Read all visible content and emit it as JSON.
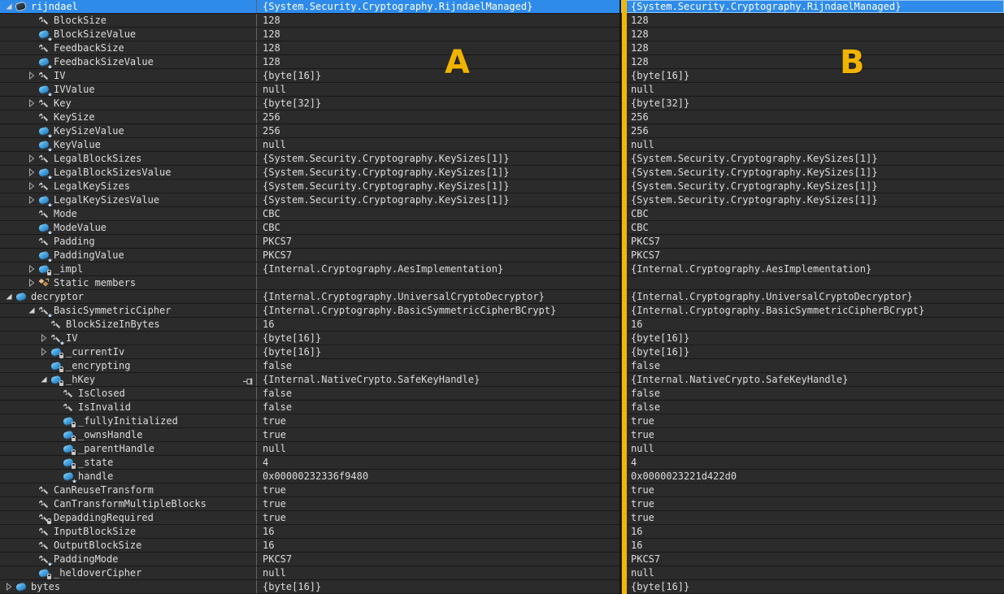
{
  "app": {
    "description": "debugger-watch-comparison",
    "root_object_type": "{System.Security.Cryptography.RijndaelManaged}"
  },
  "colors": {
    "background": "#2B2B2C",
    "selection_blue": "#2E8BEA",
    "divider_yellow": "#F2B705",
    "annotation_gold": "#F0B400",
    "row_line": "#19191A",
    "text": "#DCDCDC",
    "field_icon_blue": "#45A3DF",
    "property_icon_gray": "#C4C4C4",
    "static_icon_tan": "#DFAF72"
  },
  "annotations": {
    "panel_a_label": "A",
    "panel_b_label": "B"
  },
  "rows": [
    {
      "name": "rijndael",
      "level": 0,
      "expander": "expanded",
      "icon": "object",
      "pinned": false,
      "selected": true,
      "value_a": "{System.Security.Cryptography.RijndaelManaged}",
      "value_b": "{System.Security.Cryptography.RijndaelManaged}"
    },
    {
      "name": "BlockSize",
      "level": 1,
      "expander": "none",
      "icon": "property",
      "pinned": false,
      "selected": false,
      "value_a": "128",
      "value_b": "128"
    },
    {
      "name": "BlockSizeValue",
      "level": 1,
      "expander": "none",
      "icon": "field-protected",
      "pinned": false,
      "selected": false,
      "value_a": "128",
      "value_b": "128"
    },
    {
      "name": "FeedbackSize",
      "level": 1,
      "expander": "none",
      "icon": "property",
      "pinned": false,
      "selected": false,
      "value_a": "128",
      "value_b": "128"
    },
    {
      "name": "FeedbackSizeValue",
      "level": 1,
      "expander": "none",
      "icon": "field-protected",
      "pinned": false,
      "selected": false,
      "value_a": "128",
      "value_b": "128"
    },
    {
      "name": "IV",
      "level": 1,
      "expander": "collapsed",
      "icon": "property",
      "pinned": false,
      "selected": false,
      "value_a": "{byte[16]}",
      "value_b": "{byte[16]}"
    },
    {
      "name": "IVValue",
      "level": 1,
      "expander": "none",
      "icon": "field-protected",
      "pinned": false,
      "selected": false,
      "value_a": "null",
      "value_b": "null"
    },
    {
      "name": "Key",
      "level": 1,
      "expander": "collapsed",
      "icon": "property",
      "pinned": false,
      "selected": false,
      "value_a": "{byte[32]}",
      "value_b": "{byte[32]}"
    },
    {
      "name": "KeySize",
      "level": 1,
      "expander": "none",
      "icon": "property",
      "pinned": false,
      "selected": false,
      "value_a": "256",
      "value_b": "256"
    },
    {
      "name": "KeySizeValue",
      "level": 1,
      "expander": "none",
      "icon": "field-protected",
      "pinned": false,
      "selected": false,
      "value_a": "256",
      "value_b": "256"
    },
    {
      "name": "KeyValue",
      "level": 1,
      "expander": "none",
      "icon": "field-protected",
      "pinned": false,
      "selected": false,
      "value_a": "null",
      "value_b": "null"
    },
    {
      "name": "LegalBlockSizes",
      "level": 1,
      "expander": "collapsed",
      "icon": "property",
      "pinned": false,
      "selected": false,
      "value_a": "{System.Security.Cryptography.KeySizes[1]}",
      "value_b": "{System.Security.Cryptography.KeySizes[1]}"
    },
    {
      "name": "LegalBlockSizesValue",
      "level": 1,
      "expander": "collapsed",
      "icon": "field-protected",
      "pinned": false,
      "selected": false,
      "value_a": "{System.Security.Cryptography.KeySizes[1]}",
      "value_b": "{System.Security.Cryptography.KeySizes[1]}"
    },
    {
      "name": "LegalKeySizes",
      "level": 1,
      "expander": "collapsed",
      "icon": "property",
      "pinned": false,
      "selected": false,
      "value_a": "{System.Security.Cryptography.KeySizes[1]}",
      "value_b": "{System.Security.Cryptography.KeySizes[1]}"
    },
    {
      "name": "LegalKeySizesValue",
      "level": 1,
      "expander": "collapsed",
      "icon": "field-protected",
      "pinned": false,
      "selected": false,
      "value_a": "{System.Security.Cryptography.KeySizes[1]}",
      "value_b": "{System.Security.Cryptography.KeySizes[1]}"
    },
    {
      "name": "Mode",
      "level": 1,
      "expander": "none",
      "icon": "property",
      "pinned": false,
      "selected": false,
      "value_a": "CBC",
      "value_b": "CBC"
    },
    {
      "name": "ModeValue",
      "level": 1,
      "expander": "none",
      "icon": "field-protected",
      "pinned": false,
      "selected": false,
      "value_a": "CBC",
      "value_b": "CBC"
    },
    {
      "name": "Padding",
      "level": 1,
      "expander": "none",
      "icon": "property",
      "pinned": false,
      "selected": false,
      "value_a": "PKCS7",
      "value_b": "PKCS7"
    },
    {
      "name": "PaddingValue",
      "level": 1,
      "expander": "none",
      "icon": "field-protected",
      "pinned": false,
      "selected": false,
      "value_a": "PKCS7",
      "value_b": "PKCS7"
    },
    {
      "name": "_impl",
      "level": 1,
      "expander": "collapsed",
      "icon": "field-private",
      "pinned": false,
      "selected": false,
      "value_a": "{Internal.Cryptography.AesImplementation}",
      "value_b": "{Internal.Cryptography.AesImplementation}"
    },
    {
      "name": "Static members",
      "level": 1,
      "expander": "collapsed",
      "icon": "static",
      "pinned": false,
      "selected": false,
      "value_a": "",
      "value_b": ""
    },
    {
      "name": "decryptor",
      "level": 0,
      "expander": "expanded",
      "icon": "local",
      "pinned": false,
      "selected": false,
      "value_a": "{Internal.Cryptography.UniversalCryptoDecryptor}",
      "value_b": "{Internal.Cryptography.UniversalCryptoDecryptor}"
    },
    {
      "name": "BasicSymmetricCipher",
      "level": 1,
      "expander": "expanded",
      "icon": "property-protected",
      "pinned": false,
      "selected": false,
      "value_a": "{Internal.Cryptography.BasicSymmetricCipherBCrypt}",
      "value_b": "{Internal.Cryptography.BasicSymmetricCipherBCrypt}"
    },
    {
      "name": "BlockSizeInBytes",
      "level": 2,
      "expander": "none",
      "icon": "property",
      "pinned": false,
      "selected": false,
      "value_a": "16",
      "value_b": "16"
    },
    {
      "name": "IV",
      "level": 2,
      "expander": "collapsed",
      "icon": "property-protected",
      "pinned": false,
      "selected": false,
      "value_a": "{byte[16]}",
      "value_b": "{byte[16]}"
    },
    {
      "name": "_currentIv",
      "level": 2,
      "expander": "collapsed",
      "icon": "field-private",
      "pinned": false,
      "selected": false,
      "value_a": "{byte[16]}",
      "value_b": "{byte[16]}"
    },
    {
      "name": "_encrypting",
      "level": 2,
      "expander": "none",
      "icon": "field-private",
      "pinned": false,
      "selected": false,
      "value_a": "false",
      "value_b": "false"
    },
    {
      "name": "_hKey",
      "level": 2,
      "expander": "expanded",
      "icon": "field-private",
      "pinned": true,
      "selected": false,
      "value_a": "{Internal.NativeCrypto.SafeKeyHandle}",
      "value_b": "{Internal.NativeCrypto.SafeKeyHandle}"
    },
    {
      "name": "IsClosed",
      "level": 3,
      "expander": "none",
      "icon": "property",
      "pinned": false,
      "selected": false,
      "value_a": "false",
      "value_b": "false"
    },
    {
      "name": "IsInvalid",
      "level": 3,
      "expander": "none",
      "icon": "property",
      "pinned": false,
      "selected": false,
      "value_a": "false",
      "value_b": "false"
    },
    {
      "name": "_fullyInitialized",
      "level": 3,
      "expander": "none",
      "icon": "field-private",
      "pinned": false,
      "selected": false,
      "value_a": "true",
      "value_b": "true"
    },
    {
      "name": "_ownsHandle",
      "level": 3,
      "expander": "none",
      "icon": "field-private",
      "pinned": false,
      "selected": false,
      "value_a": "true",
      "value_b": "true"
    },
    {
      "name": "_parentHandle",
      "level": 3,
      "expander": "none",
      "icon": "field-private",
      "pinned": false,
      "selected": false,
      "value_a": "null",
      "value_b": "null"
    },
    {
      "name": "_state",
      "level": 3,
      "expander": "none",
      "icon": "field-private",
      "pinned": false,
      "selected": false,
      "value_a": "4",
      "value_b": "4"
    },
    {
      "name": "handle",
      "level": 3,
      "expander": "none",
      "icon": "field-protected",
      "pinned": false,
      "selected": false,
      "value_a": "0x00000232336f9480",
      "value_b": "0x0000023221d422d0"
    },
    {
      "name": "CanReuseTransform",
      "level": 1,
      "expander": "none",
      "icon": "property",
      "pinned": false,
      "selected": false,
      "value_a": "true",
      "value_b": "true"
    },
    {
      "name": "CanTransformMultipleBlocks",
      "level": 1,
      "expander": "none",
      "icon": "property",
      "pinned": false,
      "selected": false,
      "value_a": "true",
      "value_b": "true"
    },
    {
      "name": "DepaddingRequired",
      "level": 1,
      "expander": "none",
      "icon": "property-private",
      "pinned": false,
      "selected": false,
      "value_a": "true",
      "value_b": "true"
    },
    {
      "name": "InputBlockSize",
      "level": 1,
      "expander": "none",
      "icon": "property",
      "pinned": false,
      "selected": false,
      "value_a": "16",
      "value_b": "16"
    },
    {
      "name": "OutputBlockSize",
      "level": 1,
      "expander": "none",
      "icon": "property",
      "pinned": false,
      "selected": false,
      "value_a": "16",
      "value_b": "16"
    },
    {
      "name": "PaddingMode",
      "level": 1,
      "expander": "none",
      "icon": "property-protected",
      "pinned": false,
      "selected": false,
      "value_a": "PKCS7",
      "value_b": "PKCS7"
    },
    {
      "name": "_heldoverCipher",
      "level": 1,
      "expander": "none",
      "icon": "field-private",
      "pinned": false,
      "selected": false,
      "value_a": "null",
      "value_b": "null"
    },
    {
      "name": "bytes",
      "level": 0,
      "expander": "collapsed",
      "icon": "local",
      "pinned": false,
      "selected": false,
      "value_a": "{byte[16]}",
      "value_b": "{byte[16]}"
    }
  ]
}
